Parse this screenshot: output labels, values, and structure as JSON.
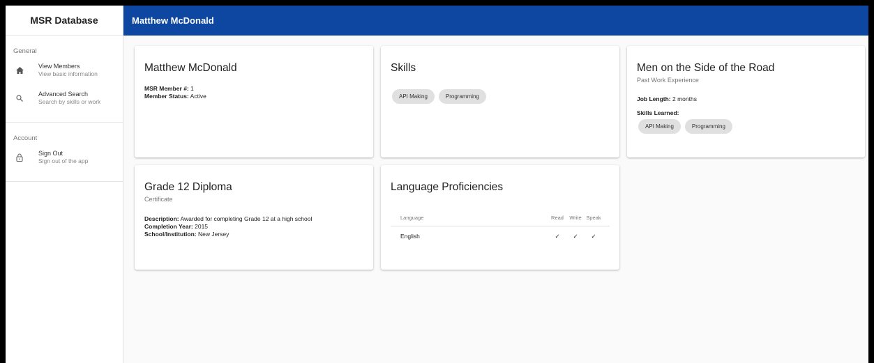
{
  "sidebar": {
    "title": "MSR Database",
    "sections": [
      {
        "header": "General",
        "items": [
          {
            "label": "View Members",
            "sub": "View basic information",
            "icon": "home-icon"
          },
          {
            "label": "Advanced Search",
            "sub": "Search by skills or work",
            "icon": "search-icon"
          }
        ]
      },
      {
        "header": "Account",
        "items": [
          {
            "label": "Sign Out",
            "sub": "Sign out of the app",
            "icon": "lock-icon"
          }
        ]
      }
    ]
  },
  "topbar": {
    "title": "Matthew McDonald"
  },
  "member_card": {
    "name": "Matthew McDonald",
    "member_no_label": "MSR Member #:",
    "member_no": "1",
    "status_label": "Member Status:",
    "status": "Active"
  },
  "skills_card": {
    "title": "Skills",
    "skills": [
      "API Making",
      "Programming"
    ]
  },
  "work_card": {
    "title": "Men on the Side of the Road",
    "subtitle": "Past Work Experience",
    "job_length_label": "Job Length:",
    "job_length": "2 months",
    "skills_learned_label": "Skills Learned:",
    "skills": [
      "API Making",
      "Programming"
    ]
  },
  "cert_card": {
    "title": "Grade 12 Diploma",
    "subtitle": "Certificate",
    "description_label": "Description:",
    "description": "Awarded for completing Grade 12 at a high school",
    "year_label": "Completion Year:",
    "year": "2015",
    "school_label": "School/Institution:",
    "school": "New Jersey"
  },
  "lang_card": {
    "title": "Language Proficiencies",
    "headers": {
      "language": "Language",
      "read": "Read",
      "write": "Write",
      "speak": "Speak"
    },
    "rows": [
      {
        "language": "English",
        "read": "✓",
        "write": "✓",
        "speak": "✓"
      }
    ]
  },
  "colors": {
    "topbar": "#0d47a1",
    "check": "#1565c0"
  }
}
